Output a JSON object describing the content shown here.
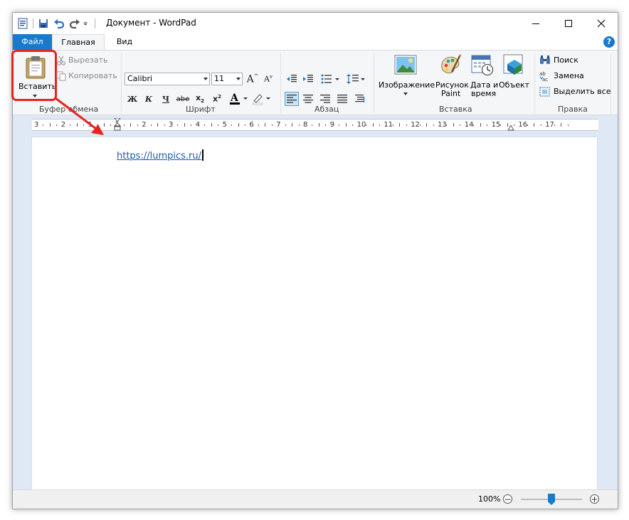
{
  "window": {
    "title": "Документ - WordPad",
    "controls": [
      "minimize-icon",
      "maximize-icon",
      "close-icon"
    ]
  },
  "tabs": {
    "file": "Файл",
    "home": "Главная",
    "view": "Вид",
    "help": "?"
  },
  "clipboard": {
    "paste_label": "Вставить",
    "cut_label": "Вырезать",
    "copy_label": "Копировать",
    "group_label": "Буфер обмена"
  },
  "font": {
    "family": "Calibri",
    "size": "11",
    "bold": "Ж",
    "italic": "К",
    "underline": "Ч",
    "strike": "abe",
    "group_label": "Шрифт"
  },
  "paragraph": {
    "group_label": "Абзац"
  },
  "insert": {
    "image_label": "Изображение",
    "paint_label_1": "Рисунок",
    "paint_label_2": "Paint",
    "datetime_label_1": "Дата и",
    "datetime_label_2": "время",
    "object_label": "Объект",
    "group_label": "Вставка"
  },
  "editing": {
    "find_label": "Поиск",
    "replace_label": "Замена",
    "select_all_label": "Выделить все",
    "group_label": "Правка"
  },
  "ruler": {
    "labels": [
      "3",
      "2",
      "1",
      "1",
      "2",
      "3",
      "4",
      "5",
      "6",
      "7",
      "8",
      "9",
      "10",
      "11",
      "12",
      "13",
      "14",
      "15",
      "16",
      "17"
    ]
  },
  "document": {
    "text": "https://lumpics.ru/"
  },
  "status": {
    "zoom": "100%"
  },
  "colors": {
    "accent": "#1979ca",
    "highlight": "#e8231f"
  }
}
